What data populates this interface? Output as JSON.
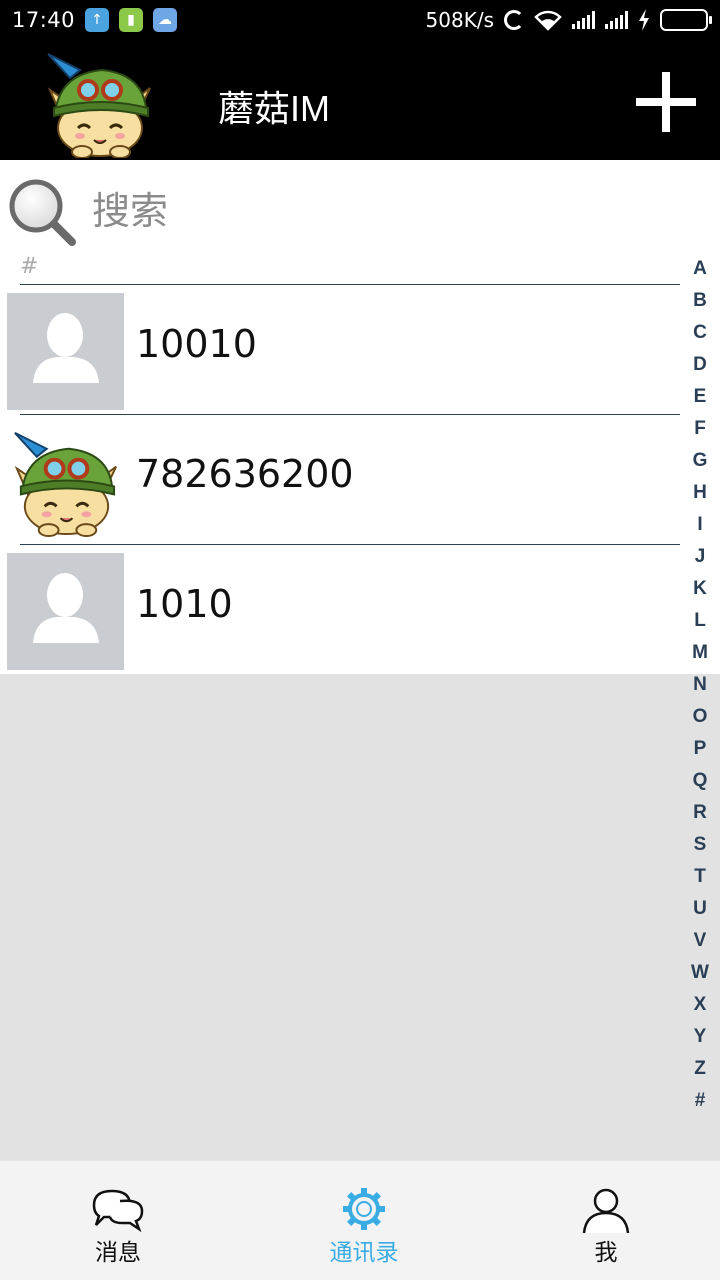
{
  "status_bar": {
    "time": "17:40",
    "net_speed": "508K/s",
    "battery_color": "#47c92e"
  },
  "header": {
    "title": "蘑菇IM",
    "add_icon": "plus-icon"
  },
  "search": {
    "placeholder": "搜索",
    "value": "",
    "icon": "search-icon"
  },
  "contacts": {
    "section_label": "#",
    "items": [
      {
        "name": "10010",
        "avatar": "placeholder-avatar"
      },
      {
        "name": "782636200",
        "avatar": "cartoon-avatar"
      },
      {
        "name": "1010",
        "avatar": "placeholder-avatar"
      }
    ]
  },
  "index_letters": [
    "A",
    "B",
    "C",
    "D",
    "E",
    "F",
    "G",
    "H",
    "I",
    "J",
    "K",
    "L",
    "M",
    "N",
    "O",
    "P",
    "Q",
    "R",
    "S",
    "T",
    "U",
    "V",
    "W",
    "X",
    "Y",
    "Z",
    "#"
  ],
  "nav": {
    "tabs": [
      {
        "label": "消息",
        "icon": "chat-bubbles-icon"
      },
      {
        "label": "通讯录",
        "icon": "gear-icon",
        "active": true
      },
      {
        "label": "我",
        "icon": "person-icon"
      }
    ],
    "active_color": "#3aace4"
  }
}
